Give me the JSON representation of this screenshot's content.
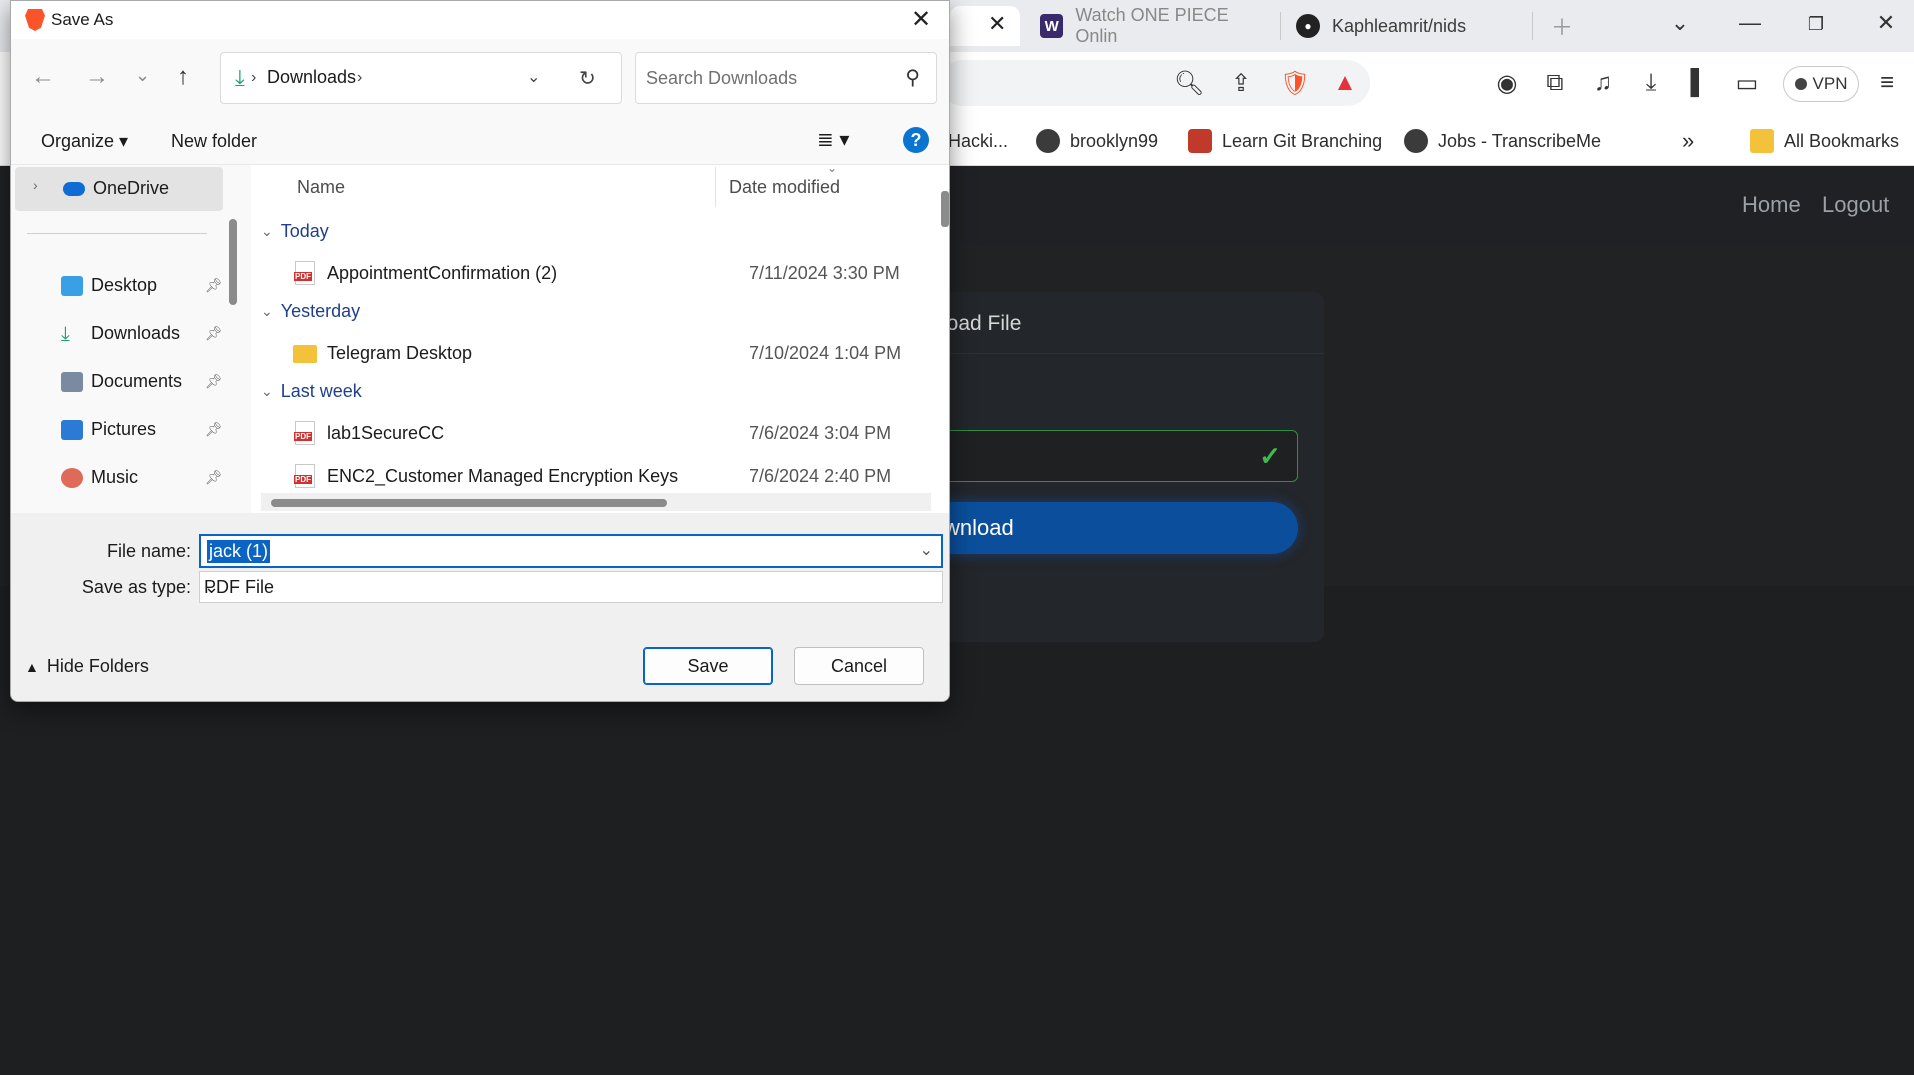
{
  "browser": {
    "tabs": [
      {
        "title": "Watch ONE PIECE Onlin",
        "favicon": "W"
      },
      {
        "title": "Kaphleamrit/nids",
        "favicon": "github-icon"
      }
    ],
    "bookmarks": [
      "Hacki...",
      "brooklyn99",
      "Learn Git Branching",
      "Jobs - TranscribeMe",
      "All Bookmarks"
    ],
    "vpn_label": "VPN",
    "colors": {
      "accent": "#0b4f9c",
      "success": "#3fb950"
    }
  },
  "page": {
    "nav": {
      "home": "Home",
      "logout": "Logout"
    },
    "card_title": "load File",
    "download_button": "wnload"
  },
  "dialog": {
    "title": "Save As",
    "location": "Downloads",
    "search_placeholder": "Search Downloads",
    "organize": "Organize",
    "new_folder": "New folder",
    "help": "?",
    "nav_pane": {
      "onedrive": "OneDrive",
      "items": [
        "Desktop",
        "Downloads",
        "Documents",
        "Pictures",
        "Music"
      ]
    },
    "columns": {
      "name": "Name",
      "date": "Date modified"
    },
    "groups": [
      {
        "label": "Today",
        "files": [
          {
            "name": "AppointmentConfirmation (2)",
            "date": "7/11/2024 3:30 PM",
            "type": "pdf"
          }
        ]
      },
      {
        "label": "Yesterday",
        "files": [
          {
            "name": "Telegram Desktop",
            "date": "7/10/2024 1:04 PM",
            "type": "folder"
          }
        ]
      },
      {
        "label": "Last week",
        "files": [
          {
            "name": "lab1SecureCC",
            "date": "7/6/2024 3:04 PM",
            "type": "pdf"
          },
          {
            "name": "ENC2_Customer Managed Encryption Keys",
            "date": "7/6/2024 2:40 PM",
            "type": "pdf"
          }
        ]
      }
    ],
    "file_name_label": "File name:",
    "file_name_value": "jack (1)",
    "save_type_label": "Save as type:",
    "save_type_value": "PDF File",
    "hide_folders": "Hide Folders",
    "save_button": "Save",
    "cancel_button": "Cancel"
  }
}
